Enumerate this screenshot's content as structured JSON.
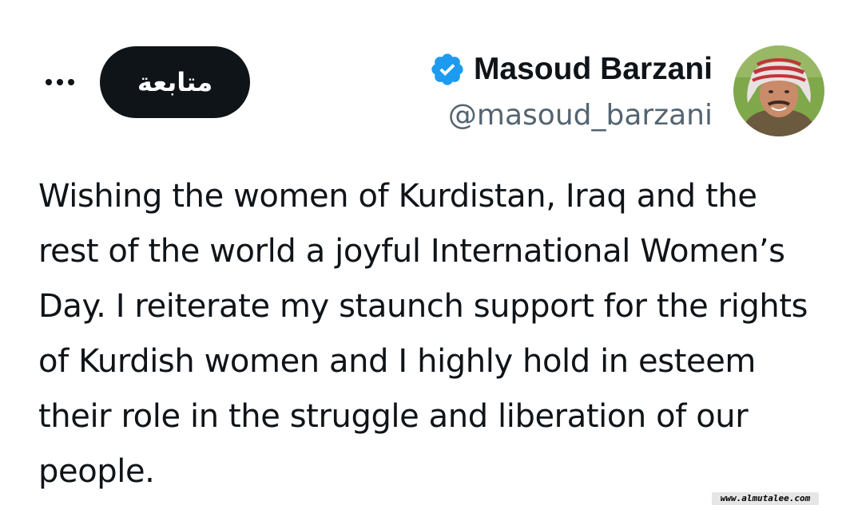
{
  "header": {
    "more_icon": "more-horizontal-icon",
    "follow_label": "متابعة",
    "display_name": "Masoud Barzani",
    "verified_icon": "verified-badge-icon",
    "handle": "@masoud_barzani",
    "avatar_icon": "profile-avatar"
  },
  "tweet": {
    "text": "Wishing the women of Kurdistan, Iraq and the rest of the world a joyful International Women’s Day. I reiterate my staunch support for the rights of Kurdish women and I highly hold in esteem their role in the struggle and liberation of our people."
  },
  "watermark": {
    "text": "www.almutalee.com"
  },
  "colors": {
    "text_primary": "#0f1419",
    "text_secondary": "#536471",
    "verified_blue": "#1d9bf0",
    "follow_button_bg": "#0f1419"
  }
}
